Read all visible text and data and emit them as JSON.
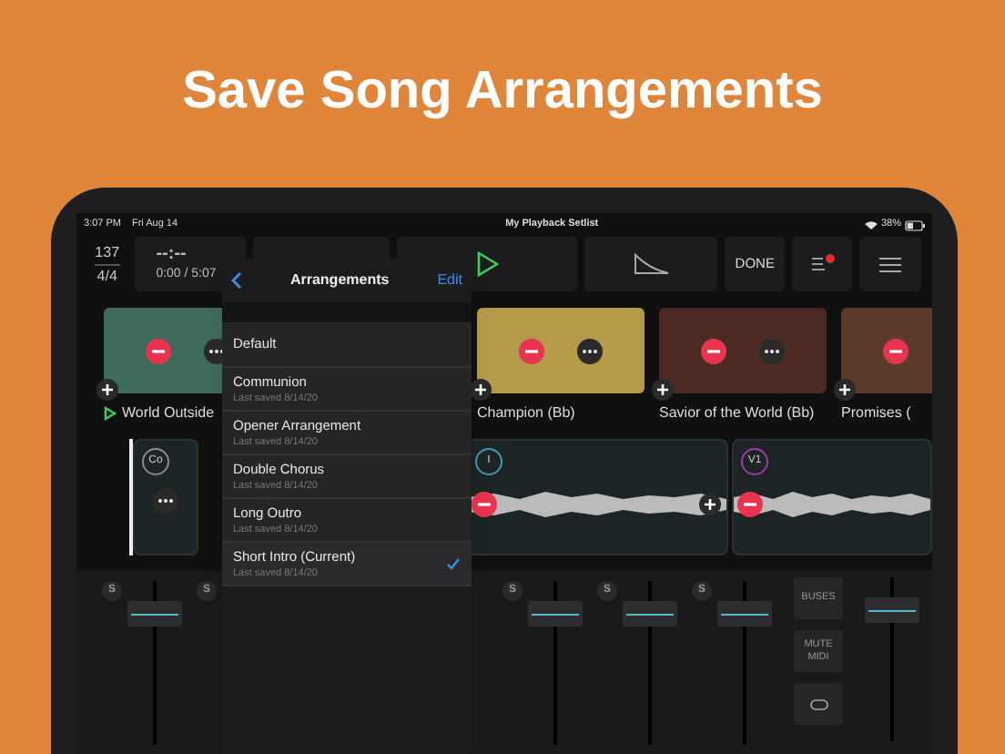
{
  "headline": "Save Song Arrangements",
  "status_bar": {
    "time": "3:07 PM",
    "date": "Fri Aug 14",
    "title": "My Playback Setlist",
    "battery": "38%"
  },
  "toolbar": {
    "tempo": "137",
    "meter": "4/4",
    "counter": "--:--",
    "position": "0:00 / 5:07",
    "done": "DONE"
  },
  "songs": [
    {
      "title": "World Outside",
      "playing": true
    },
    {
      "title": "Champion (Bb)",
      "playing": false
    },
    {
      "title": "Savior of the World (Bb)",
      "playing": false
    },
    {
      "title": "Promises (",
      "playing": false
    }
  ],
  "sections": [
    {
      "label": "Co",
      "color": "#8a8a8a"
    },
    {
      "label": "I",
      "color": "#3aa0b0"
    },
    {
      "label": "V1",
      "color": "#a03aa8"
    }
  ],
  "arrangements": {
    "title": "Arrangements",
    "edit": "Edit",
    "items": [
      {
        "name": "Default",
        "selected": false
      },
      {
        "name": "Communion",
        "saved": "Last saved 8/14/20",
        "selected": false
      },
      {
        "name": "Opener Arrangement",
        "saved": "Last saved 8/14/20",
        "selected": false
      },
      {
        "name": "Double Chorus",
        "saved": "Last saved 8/14/20",
        "selected": false
      },
      {
        "name": "Long Outro",
        "saved": "Last saved 8/14/20",
        "selected": false
      },
      {
        "name": "Short Intro (Current)",
        "saved": "Last saved 8/14/20",
        "selected": true
      }
    ]
  },
  "mixer": {
    "channels": [
      {
        "solo": "S",
        "level": 0.85
      },
      {
        "solo": "S"
      },
      {
        "solo": "S",
        "level": 0.85
      },
      {
        "solo": "S",
        "level": 0.85
      },
      {
        "solo": "S",
        "level": 0.85
      }
    ],
    "buses": "BUSES",
    "mute_midi": "MUTE MIDI",
    "master": {
      "level": 0.85
    }
  }
}
